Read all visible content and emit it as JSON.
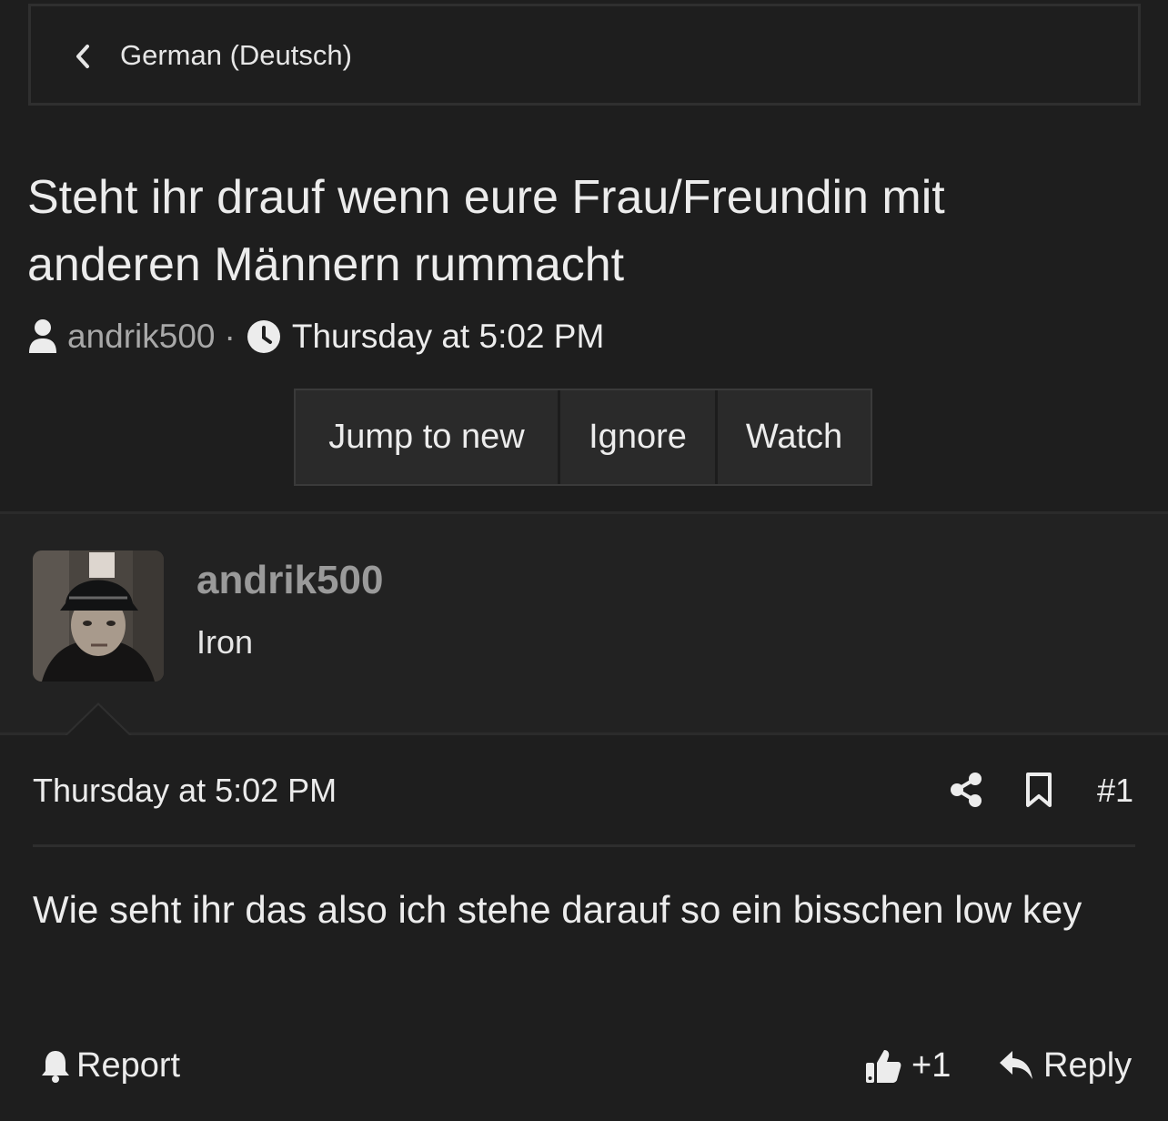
{
  "breadcrumb": {
    "label": "German (Deutsch)"
  },
  "thread": {
    "title": "Steht ihr drauf wenn eure Frau/Freundin mit anderen Männern rummacht",
    "author": "andrik500",
    "separator": "·",
    "date": "Thursday at 5:02 PM"
  },
  "thread_actions": {
    "jump": "Jump to new",
    "ignore": "Ignore",
    "watch": "Watch"
  },
  "post": {
    "username": "andrik500",
    "user_title": "Iron",
    "date": "Thursday at 5:02 PM",
    "number": "#1",
    "body": "Wie seht ihr das also ich stehe darauf so ein bisschen low key",
    "report_label": "Report",
    "reaction_count": "+1",
    "reply_label": "Reply"
  },
  "icons": {
    "back": "chevron-left-icon",
    "user": "user-icon",
    "clock": "clock-icon",
    "share": "share-icon",
    "bookmark": "bookmark-icon",
    "report": "bell-icon",
    "like": "thumbs-up-icon",
    "reply": "reply-icon"
  },
  "colors": {
    "background": "#1e1e1e",
    "panel": "#222222",
    "button": "#2a2a2a",
    "text": "#ececec",
    "muted": "#a8a8a8"
  }
}
